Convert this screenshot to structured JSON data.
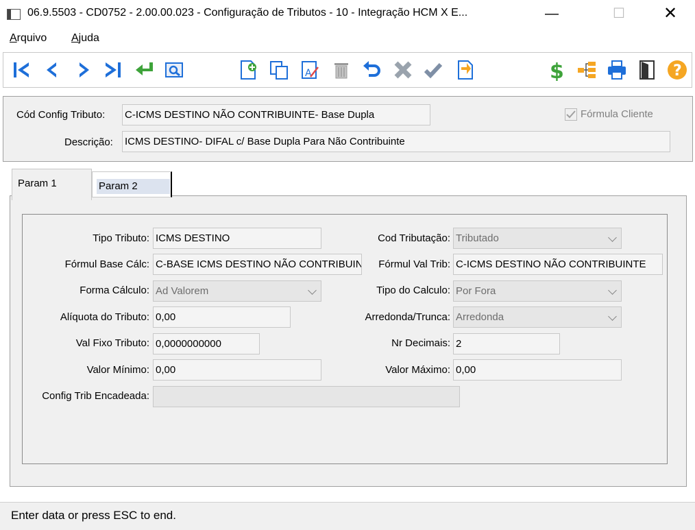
{
  "window": {
    "title": "06.9.5503 - CD0752 - 2.00.00.023 - Configuração de Tributos - 10 - Integração HCM X E...",
    "minimize": "—",
    "maximize": "☐",
    "close": "✕"
  },
  "menu": {
    "items": [
      {
        "label": "Arquivo",
        "accel": "A"
      },
      {
        "label": "Ajuda",
        "accel": "A"
      }
    ]
  },
  "toolbar": {
    "icons": [
      "first-icon",
      "previous-icon",
      "next-icon",
      "last-icon",
      "goto-icon",
      "search-icon",
      "new-icon",
      "copy-icon",
      "edit-icon",
      "delete-icon",
      "undo-icon",
      "cancel-icon",
      "confirm-icon",
      "import-icon",
      "dollar-icon",
      "tree-icon",
      "print-icon",
      "exit-icon",
      "help-icon"
    ]
  },
  "header": {
    "cod_label": "Cód Config Tributo:",
    "cod_value": "C-ICMS DESTINO NÃO CONTRIBUINTE- Base Dupla",
    "desc_label": "Descrição:",
    "desc_value": "ICMS DESTINO- DIFAL c/ Base Dupla Para Não Contribuinte",
    "formula_cliente_label": "Fórmula Cliente",
    "formula_cliente_checked": true
  },
  "tabs": [
    {
      "label": "Param 1",
      "active": true
    },
    {
      "label": "Param 2",
      "active": false
    }
  ],
  "form": {
    "tipo_tributo": {
      "label": "Tipo Tributo:",
      "value": "ICMS DESTINO"
    },
    "formul_base": {
      "label": "Fórmul Base Cálc:",
      "value": "C-BASE ICMS DESTINO NÃO CONTRIBUINTE"
    },
    "forma_calculo": {
      "label": "Forma Cálculo:",
      "value": "Ad Valorem"
    },
    "aliquota": {
      "label": "Alíquota do Tributo:",
      "value": "0,00"
    },
    "val_fixo": {
      "label": "Val Fixo Tributo:",
      "value": "0,0000000000"
    },
    "valor_minimo": {
      "label": "Valor Mínimo:",
      "value": "0,00"
    },
    "config_encadeada": {
      "label": "Config Trib Encadeada:",
      "value": ""
    },
    "cod_tributacao": {
      "label": "Cod Tributação:",
      "value": "Tributado"
    },
    "formul_val_trib": {
      "label": "Fórmul Val Trib:",
      "value": "C-ICMS DESTINO NÃO CONTRIBUINTE"
    },
    "tipo_calculo": {
      "label": "Tipo do Calculo:",
      "value": "Por Fora"
    },
    "arredonda": {
      "label": "Arredonda/Trunca:",
      "value": "Arredonda"
    },
    "nr_decimais": {
      "label": "Nr Decimais:",
      "value": "2"
    },
    "valor_maximo": {
      "label": "Valor Máximo:",
      "value": "0,00"
    }
  },
  "status": {
    "text": "Enter data or press ESC to end."
  },
  "colors": {
    "nav_blue": "#1e6fd9",
    "green": "#3ea33a",
    "orange": "#f5a623",
    "gray_icon": "#9a9a9a"
  }
}
